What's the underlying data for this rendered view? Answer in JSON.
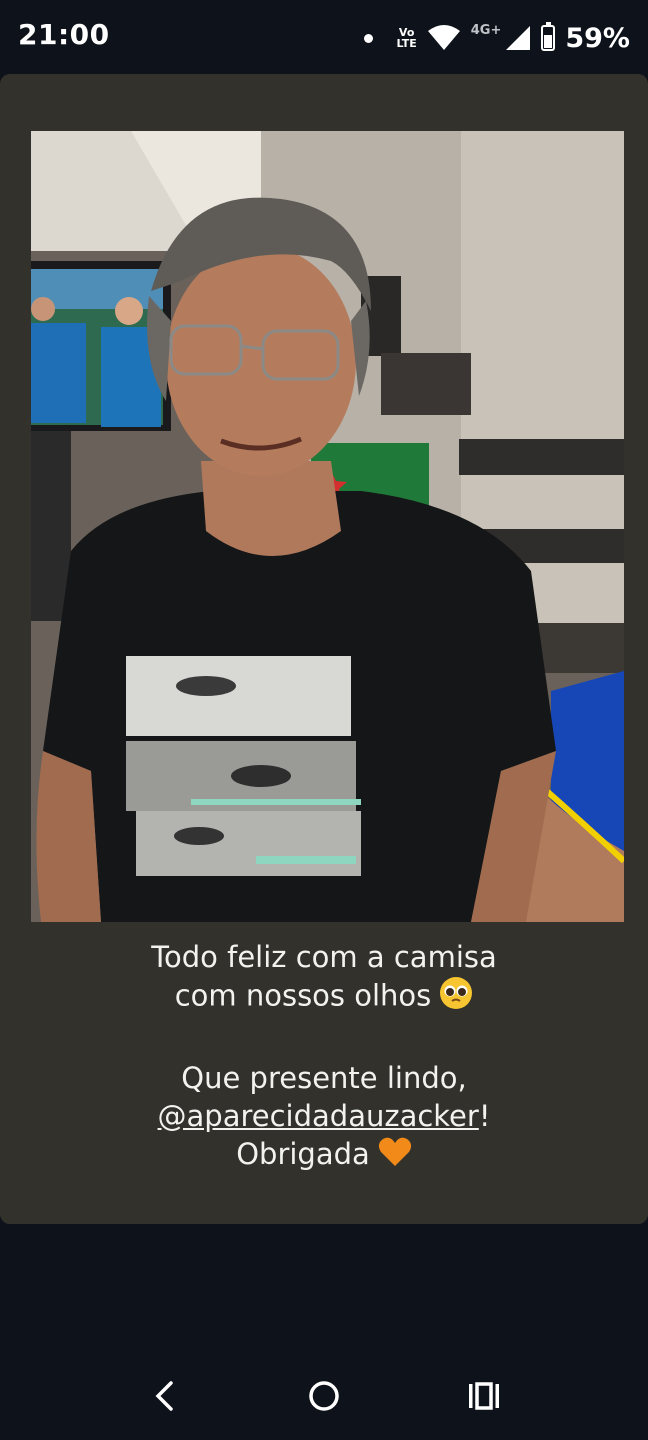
{
  "status_bar": {
    "time": "21:00",
    "volte_line1": "Vo",
    "volte_line2": "LTE",
    "network": "4G+",
    "battery": "59%",
    "battery_level": 0.59,
    "icons": [
      "notification-dot-icon",
      "volte-icon",
      "wifi-icon",
      "signal-icon",
      "battery-icon"
    ]
  },
  "story": {
    "caption_line1": "Todo feliz com a camisa",
    "caption_line2": "com nossos olhos",
    "caption_line3": "Que presente lindo,",
    "mention": "@aparecidadauzacker",
    "mention_suffix": "!",
    "caption_line5": "Obrigada",
    "emoji1": "pleading-face-icon",
    "emoji2": "orange-heart-icon"
  },
  "navigation": {
    "icons": [
      "back-icon",
      "home-icon",
      "recents-icon"
    ]
  },
  "colors": {
    "background": "#0e121a",
    "card": "#32312c",
    "heart": "#f28a1a"
  }
}
